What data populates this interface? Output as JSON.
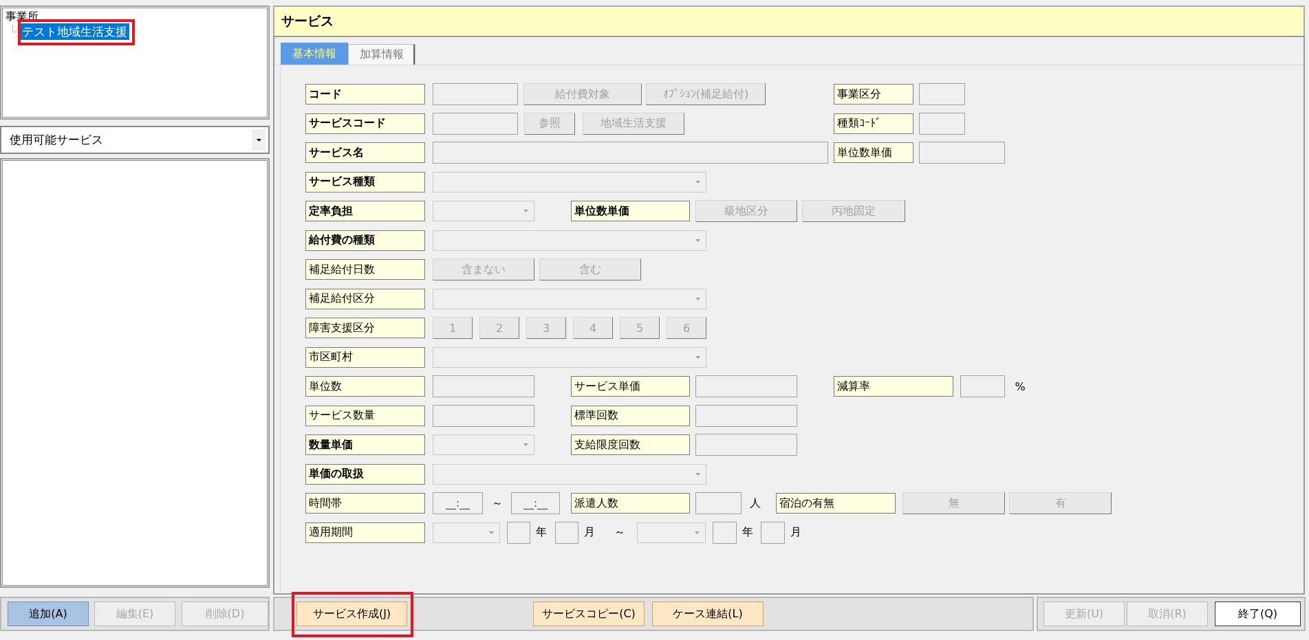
{
  "tree": {
    "root": "事業所",
    "children": [
      {
        "label": "テスト地域生活支援",
        "selected": true,
        "highlighted": true
      }
    ]
  },
  "service_filter": {
    "value": "使用可能サービス"
  },
  "panel": {
    "title": "サービス"
  },
  "tabs": [
    {
      "label": "基本情報",
      "selected": true
    },
    {
      "label": "加算情報",
      "selected": false
    }
  ],
  "form_rows": [
    {
      "items": [
        {
          "kind": "label",
          "text": "コード",
          "bold": true
        },
        {
          "kind": "field"
        },
        {
          "kind": "button",
          "text": "給付費対象",
          "disabled": true
        },
        {
          "kind": "button",
          "text": "ｵﾌﾟｼｮﾝ(補足給付)",
          "disabled": true
        },
        {
          "kind": "label",
          "text": "事業区分",
          "bold": false
        },
        {
          "kind": "field"
        }
      ]
    },
    {
      "items": [
        {
          "kind": "label",
          "text": "サービスコード",
          "bold": true
        },
        {
          "kind": "field"
        },
        {
          "kind": "button",
          "text": "参照",
          "disabled": true
        },
        {
          "kind": "button",
          "text": "地域生活支援",
          "disabled": true
        },
        {
          "kind": "label",
          "text": "種類ｺｰﾄﾞ",
          "bold": false
        },
        {
          "kind": "field"
        }
      ]
    },
    {
      "items": [
        {
          "kind": "label",
          "text": "サービス名",
          "bold": true
        },
        {
          "kind": "field"
        },
        {
          "kind": "label",
          "text": "単位数単価",
          "bold": false
        },
        {
          "kind": "field"
        }
      ]
    },
    {
      "items": [
        {
          "kind": "label",
          "text": "サービス種類",
          "bold": true
        },
        {
          "kind": "combo"
        }
      ]
    },
    {
      "items": [
        {
          "kind": "label",
          "text": "定率負担",
          "bold": true
        },
        {
          "kind": "combo"
        },
        {
          "kind": "label",
          "text": "単位数単価",
          "bold": true
        },
        {
          "kind": "button",
          "text": "級地区分",
          "disabled": true
        },
        {
          "kind": "button",
          "text": "丙地固定",
          "disabled": true
        }
      ]
    },
    {
      "items": [
        {
          "kind": "label",
          "text": "給付費の種類",
          "bold": true
        },
        {
          "kind": "combo"
        }
      ]
    },
    {
      "items": [
        {
          "kind": "label",
          "text": "補足給付日数",
          "bold": false
        },
        {
          "kind": "button",
          "text": "含まない",
          "disabled": true
        },
        {
          "kind": "button",
          "text": "含む",
          "disabled": true
        }
      ]
    },
    {
      "items": [
        {
          "kind": "label",
          "text": "補足給付区分",
          "bold": false
        },
        {
          "kind": "combo"
        }
      ]
    },
    {
      "items": [
        {
          "kind": "label",
          "text": "障害支援区分",
          "bold": false
        },
        {
          "kind": "button",
          "text": "1",
          "disabled": true
        },
        {
          "kind": "button",
          "text": "2",
          "disabled": true
        },
        {
          "kind": "button",
          "text": "3",
          "disabled": true
        },
        {
          "kind": "button",
          "text": "4",
          "disabled": true
        },
        {
          "kind": "button",
          "text": "5",
          "disabled": true
        },
        {
          "kind": "button",
          "text": "6",
          "disabled": true
        }
      ]
    },
    {
      "items": [
        {
          "kind": "label",
          "text": "市区町村",
          "bold": false
        },
        {
          "kind": "combo"
        }
      ]
    },
    {
      "items": [
        {
          "kind": "label",
          "text": "単位数",
          "bold": false
        },
        {
          "kind": "field"
        },
        {
          "kind": "label",
          "text": "サービス単価",
          "bold": false
        },
        {
          "kind": "field"
        },
        {
          "kind": "label",
          "text": "減算率",
          "bold": false
        },
        {
          "kind": "field"
        },
        {
          "kind": "text",
          "text": "%"
        }
      ]
    },
    {
      "items": [
        {
          "kind": "label",
          "text": "サービス数量",
          "bold": false
        },
        {
          "kind": "field"
        },
        {
          "kind": "label",
          "text": "標準回数",
          "bold": false
        },
        {
          "kind": "field"
        }
      ]
    },
    {
      "items": [
        {
          "kind": "label",
          "text": "数量単価",
          "bold": true
        },
        {
          "kind": "combo"
        },
        {
          "kind": "label",
          "text": "支給限度回数",
          "bold": false
        },
        {
          "kind": "field"
        }
      ]
    },
    {
      "items": [
        {
          "kind": "label",
          "text": "単価の取扱",
          "bold": true
        },
        {
          "kind": "combo"
        }
      ]
    },
    {
      "items": [
        {
          "kind": "label",
          "text": "時間帯",
          "bold": false
        },
        {
          "kind": "field",
          "value": "__:__"
        },
        {
          "kind": "text",
          "text": "～"
        },
        {
          "kind": "field",
          "value": "__:__"
        },
        {
          "kind": "label",
          "text": "派遣人数",
          "bold": false
        },
        {
          "kind": "field"
        },
        {
          "kind": "text",
          "text": "人"
        },
        {
          "kind": "label",
          "text": "宿泊の有無",
          "bold": false
        },
        {
          "kind": "button",
          "text": "無",
          "disabled": true
        },
        {
          "kind": "button",
          "text": "有",
          "disabled": true
        }
      ]
    },
    {
      "items": [
        {
          "kind": "label",
          "text": "適用期間",
          "bold": false
        },
        {
          "kind": "combo"
        },
        {
          "kind": "field"
        },
        {
          "kind": "text",
          "text": "年"
        },
        {
          "kind": "field"
        },
        {
          "kind": "text",
          "text": "月"
        },
        {
          "kind": "text",
          "text": "～"
        },
        {
          "kind": "combo"
        },
        {
          "kind": "field"
        },
        {
          "kind": "text",
          "text": "年"
        },
        {
          "kind": "field"
        },
        {
          "kind": "text",
          "text": "月"
        }
      ]
    }
  ],
  "bottom_groups": [
    {
      "buttons": [
        {
          "label": "追加(A)",
          "kind": "active",
          "disabled": false
        },
        {
          "label": "編集(E)",
          "kind": "plain",
          "disabled": true
        },
        {
          "label": "削除(D)",
          "kind": "plain",
          "disabled": true
        }
      ]
    },
    {
      "buttons": [
        {
          "label": "サービス作成(J)",
          "kind": "accent",
          "disabled": false,
          "highlighted": true
        },
        {
          "label": "サービスコピー(C)",
          "kind": "accent",
          "disabled": false
        },
        {
          "label": "ケース連結(L)",
          "kind": "accent",
          "disabled": false
        }
      ]
    },
    {
      "buttons": [
        {
          "label": "更新(U)",
          "kind": "plain",
          "disabled": true
        },
        {
          "label": "取消(R)",
          "kind": "plain",
          "disabled": true
        },
        {
          "label": "終了(Q)",
          "kind": "strong",
          "disabled": false
        }
      ]
    }
  ]
}
